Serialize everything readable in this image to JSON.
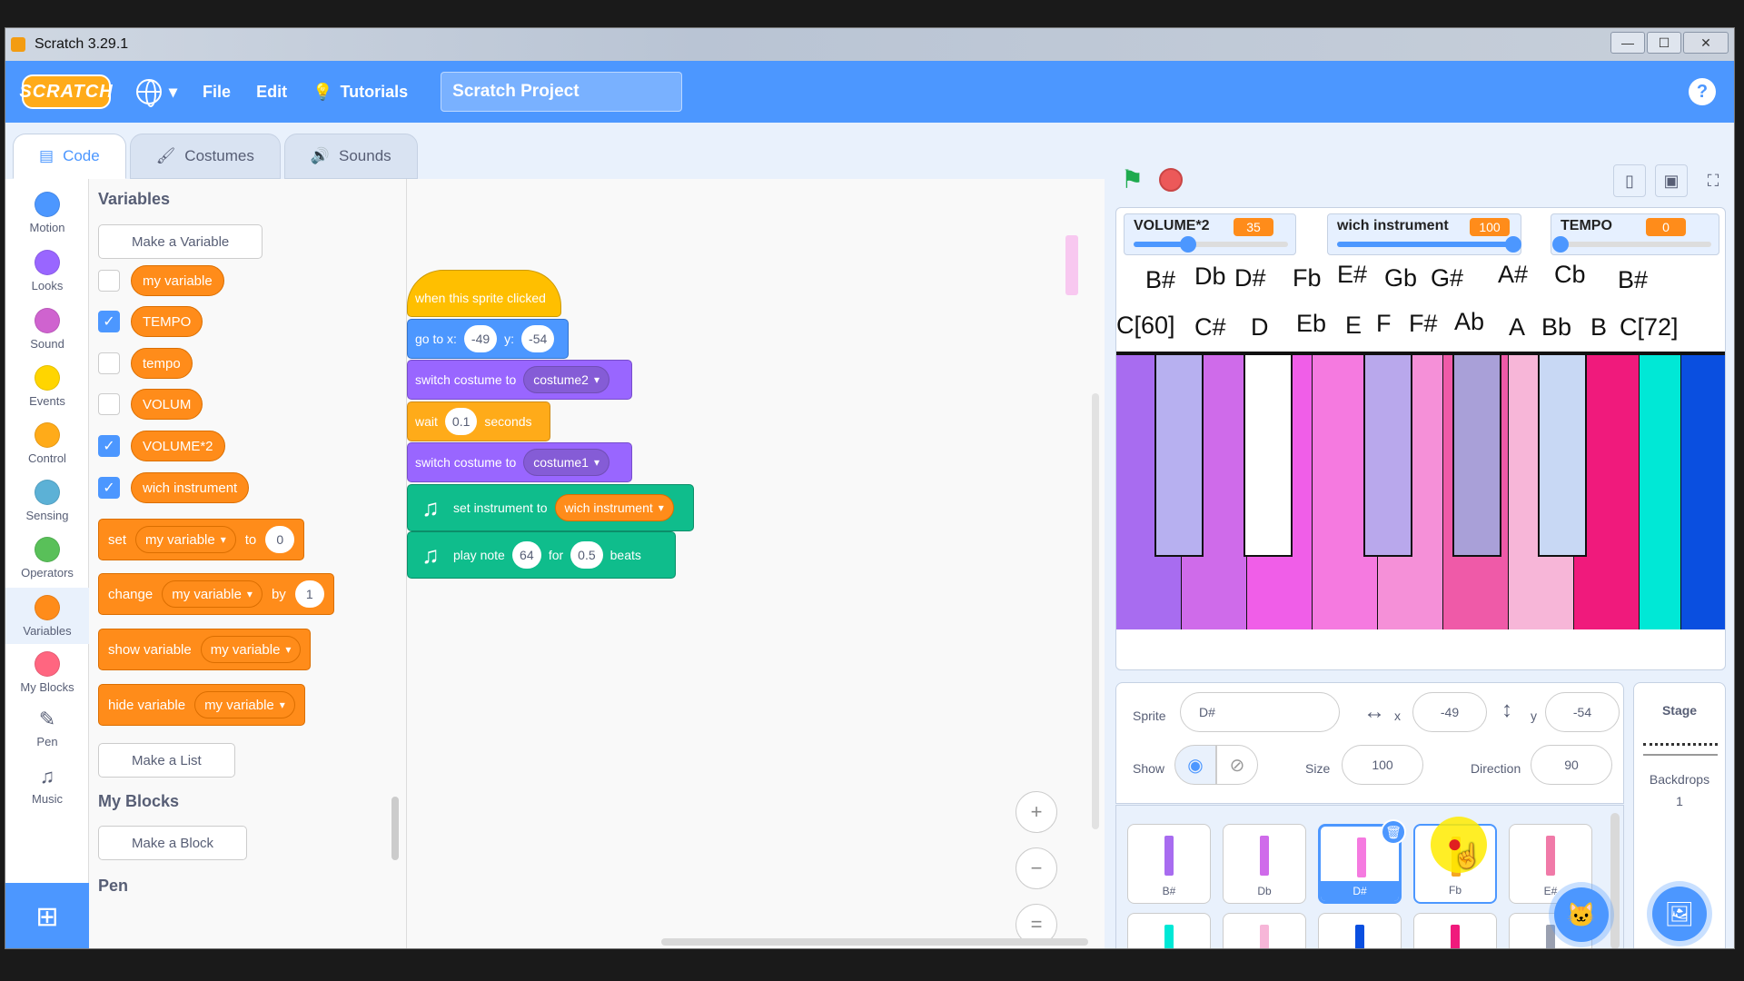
{
  "window": {
    "title": "Scratch 3.29.1",
    "controls": [
      "—",
      "☐",
      "✕"
    ]
  },
  "menubar": {
    "logo": "SCRATCH",
    "file": "File",
    "edit": "Edit",
    "tutorials": "Tutorials",
    "project_title": "Scratch Project",
    "help": "?"
  },
  "tabs": {
    "code": "Code",
    "costumes": "Costumes",
    "sounds": "Sounds"
  },
  "categories": [
    {
      "label": "Motion",
      "color": "#4c97ff"
    },
    {
      "label": "Looks",
      "color": "#9966ff"
    },
    {
      "label": "Sound",
      "color": "#cf63cf"
    },
    {
      "label": "Events",
      "color": "#ffd500"
    },
    {
      "label": "Control",
      "color": "#ffab19"
    },
    {
      "label": "Sensing",
      "color": "#5cb1d6"
    },
    {
      "label": "Operators",
      "color": "#59c059"
    },
    {
      "label": "Variables",
      "color": "#ff8c1a"
    },
    {
      "label": "My Blocks",
      "color": "#ff6680"
    },
    {
      "label": "Pen",
      "color": "#0fbd8c"
    },
    {
      "label": "Music",
      "color": "#0fbd8c"
    }
  ],
  "palette": {
    "variables_header": "Variables",
    "make_variable": "Make a Variable",
    "variables": [
      {
        "name": "my variable",
        "checked": false
      },
      {
        "name": "TEMPO",
        "checked": true
      },
      {
        "name": "tempo",
        "checked": false
      },
      {
        "name": "VOLUM",
        "checked": false
      },
      {
        "name": "VOLUME*2",
        "checked": true
      },
      {
        "name": "wich instrument",
        "checked": true
      }
    ],
    "set_block": {
      "verb": "set",
      "var": "my variable",
      "to": "to",
      "value": "0"
    },
    "change_block": {
      "verb": "change",
      "var": "my variable",
      "by": "by",
      "value": "1"
    },
    "show_block": {
      "verb": "show variable",
      "var": "my variable"
    },
    "hide_block": {
      "verb": "hide variable",
      "var": "my variable"
    },
    "make_list": "Make a List",
    "myblocks_header": "My Blocks",
    "make_block": "Make a Block",
    "pen_header": "Pen"
  },
  "script": {
    "hat": "when this sprite clicked",
    "goto": {
      "label": "go to x:",
      "x": "-49",
      "ylabel": "y:",
      "y": "-54"
    },
    "switch1": {
      "label": "switch costume to",
      "costume": "costume2"
    },
    "wait": {
      "label": "wait",
      "value": "0.1",
      "unit": "seconds"
    },
    "switch2": {
      "label": "switch costume to",
      "costume": "costume1"
    },
    "set_instrument": {
      "label": "set instrument to",
      "value": "wich instrument"
    },
    "play_note": {
      "label": "play note",
      "note": "64",
      "for": "for",
      "beats_value": "0.5",
      "beats": "beats"
    },
    "zoom_in": "+",
    "zoom_out": "−",
    "zoom_reset": "="
  },
  "monitors": [
    {
      "label": "VOLUME*2",
      "value": "35",
      "level": 0.35
    },
    {
      "label": "wich instrument",
      "value": "100",
      "level": 1.0
    },
    {
      "label": "TEMPO",
      "value": "0",
      "level": 0.0
    }
  ],
  "stage_notes_top": [
    "B#",
    "Db",
    "D#",
    "Fb",
    "E#",
    "Gb",
    "G#",
    "A#",
    "Cb",
    "B#"
  ],
  "stage_notes_bottom": [
    "C[60]",
    "C#",
    "D",
    "Eb",
    "E",
    "F",
    "F#",
    "Ab",
    "A",
    "Bb",
    "B",
    "C[72]"
  ],
  "piano_white_keys": [
    "#a86cf0",
    "#cf6bea",
    "#f05ee8",
    "#f57ae0",
    "#f590d8",
    "#ef5aa8",
    "#f7b6d8",
    "#f01a7c",
    "#00e8d6",
    "#0a4fe0"
  ],
  "piano_black_keys": [
    "#b7b0f0",
    "#ffffff",
    "#b9a8ec",
    "#a9a0d8",
    "#c8d8f4"
  ],
  "sprite_info": {
    "sprite_label": "Sprite",
    "sprite_name": "D#",
    "x_label": "x",
    "x": "-49",
    "y_label": "y",
    "y": "-54",
    "show_label": "Show",
    "size_label": "Size",
    "size": "100",
    "direction_label": "Direction",
    "direction": "90"
  },
  "sprites": [
    {
      "name": "B#",
      "color": "#a86cf0"
    },
    {
      "name": "Db",
      "color": "#cf6bea"
    },
    {
      "name": "D#",
      "color": "#f57ae0"
    },
    {
      "name": "Fb",
      "color": "#f5a623"
    },
    {
      "name": "E#",
      "color": "#f07aa8"
    },
    {
      "name": "",
      "color": "#00e8d6"
    },
    {
      "name": "",
      "color": "#f7b6d8"
    },
    {
      "name": "",
      "color": "#0a4fe0"
    },
    {
      "name": "",
      "color": "#f01a7c"
    },
    {
      "name": "",
      "color": "#9aa0b0"
    }
  ],
  "stage_panel": {
    "title": "Stage",
    "backdrops_label": "Backdrops",
    "backdrops_count": "1"
  }
}
